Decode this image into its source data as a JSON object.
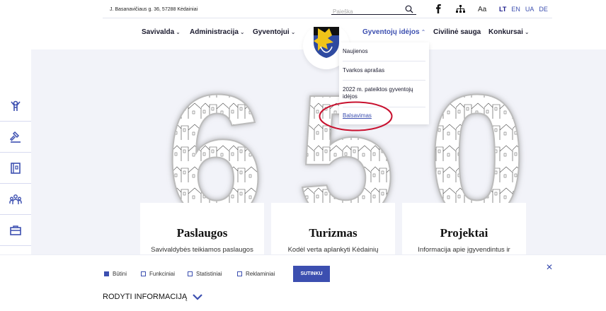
{
  "topbar": {
    "address": "J. Basanavičiaus g. 36, 57288 Kėdainiai",
    "search_placeholder": "Paieška",
    "font_size_label": "Aa",
    "languages": [
      "LT",
      "EN",
      "UA",
      "DE"
    ],
    "active_language": "LT"
  },
  "nav": {
    "items": [
      {
        "label": "Savivalda"
      },
      {
        "label": "Administracija"
      },
      {
        "label": "Gyventojui"
      },
      {
        "label": "Gyventojų idėjos"
      },
      {
        "label": "Civilinė sauga"
      },
      {
        "label": "Konkursai"
      }
    ]
  },
  "dropdown": {
    "items": [
      {
        "label": "Naujienos"
      },
      {
        "label": "Tvarkos aprašas"
      },
      {
        "label": "2022 m. pateiktos gyventojų idėjos"
      },
      {
        "label": "Balsavimas"
      }
    ]
  },
  "hero": {
    "digits": [
      "6",
      "5",
      "0"
    ]
  },
  "cards": [
    {
      "title": "Paslaugos",
      "text": "Savivaldybės teikiamos paslaugos"
    },
    {
      "title": "Turizmas",
      "text": "Kodėl verta aplankyti Kėdainių"
    },
    {
      "title": "Projektai",
      "text": "Informacija apie įgyvendintus ir"
    }
  ],
  "cookie": {
    "options": [
      {
        "label": "Būtini",
        "checked": true
      },
      {
        "label": "Funkciniai",
        "checked": false
      },
      {
        "label": "Statistiniai",
        "checked": false
      },
      {
        "label": "Reklaminiai",
        "checked": false
      }
    ],
    "agree_label": "SUTINKU",
    "show_info_label": "RODYTI INFORMACIJĄ"
  },
  "colors": {
    "accent": "#3c4fb0",
    "dark": "#1a1a2e",
    "highlight": "#c8102e",
    "hero_bg": "#f2f3f9"
  }
}
